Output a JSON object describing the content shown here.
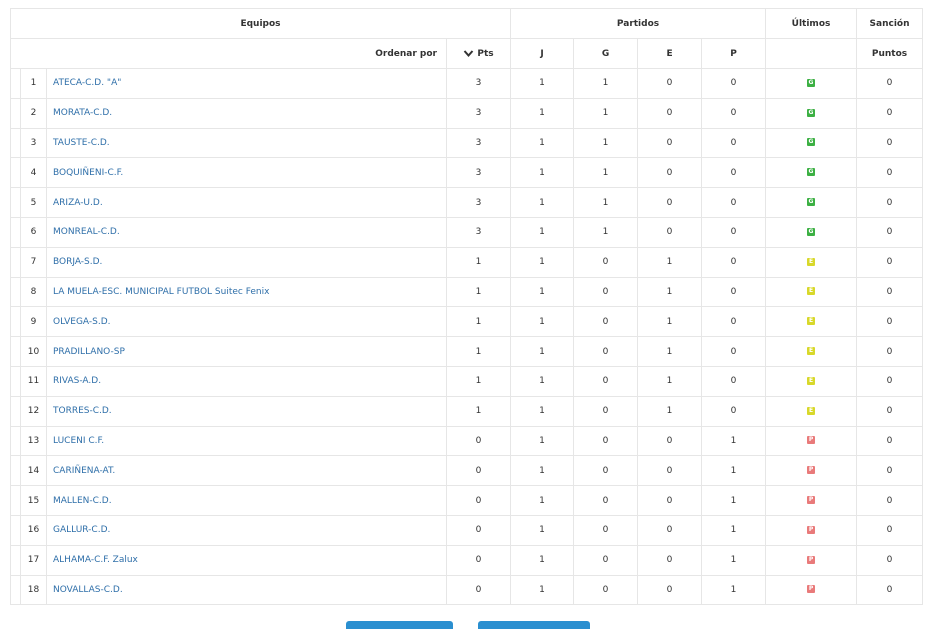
{
  "header": {
    "equipos": "Equipos",
    "partidos": "Partidos",
    "ultimos": "Últimos",
    "sancion": "Sanción",
    "ordenar_por": "Ordenar por",
    "pts": "Pts",
    "j": "J",
    "g": "G",
    "e": "E",
    "p": "P",
    "puntos": "Puntos"
  },
  "result_colors": {
    "G": "#3cb043",
    "E": "#d8d82a",
    "P": "#e97a7a"
  },
  "rows": [
    {
      "pos": "1",
      "team": "ATECA-C.D. \"A\"",
      "pts": "3",
      "j": "1",
      "g": "1",
      "e": "0",
      "p": "0",
      "last": "G",
      "sancion": "0"
    },
    {
      "pos": "2",
      "team": "MORATA-C.D.",
      "pts": "3",
      "j": "1",
      "g": "1",
      "e": "0",
      "p": "0",
      "last": "G",
      "sancion": "0"
    },
    {
      "pos": "3",
      "team": "TAUSTE-C.D.",
      "pts": "3",
      "j": "1",
      "g": "1",
      "e": "0",
      "p": "0",
      "last": "G",
      "sancion": "0"
    },
    {
      "pos": "4",
      "team": "BOQUIÑENI-C.F.",
      "pts": "3",
      "j": "1",
      "g": "1",
      "e": "0",
      "p": "0",
      "last": "G",
      "sancion": "0"
    },
    {
      "pos": "5",
      "team": "ARIZA-U.D.",
      "pts": "3",
      "j": "1",
      "g": "1",
      "e": "0",
      "p": "0",
      "last": "G",
      "sancion": "0"
    },
    {
      "pos": "6",
      "team": "MONREAL-C.D.",
      "pts": "3",
      "j": "1",
      "g": "1",
      "e": "0",
      "p": "0",
      "last": "G",
      "sancion": "0"
    },
    {
      "pos": "7",
      "team": "BORJA-S.D.",
      "pts": "1",
      "j": "1",
      "g": "0",
      "e": "1",
      "p": "0",
      "last": "E",
      "sancion": "0"
    },
    {
      "pos": "8",
      "team": "LA MUELA-ESC. MUNICIPAL FUTBOL Suitec Fenix",
      "pts": "1",
      "j": "1",
      "g": "0",
      "e": "1",
      "p": "0",
      "last": "E",
      "sancion": "0"
    },
    {
      "pos": "9",
      "team": "OLVEGA-S.D.",
      "pts": "1",
      "j": "1",
      "g": "0",
      "e": "1",
      "p": "0",
      "last": "E",
      "sancion": "0"
    },
    {
      "pos": "10",
      "team": "PRADILLANO-SP",
      "pts": "1",
      "j": "1",
      "g": "0",
      "e": "1",
      "p": "0",
      "last": "E",
      "sancion": "0"
    },
    {
      "pos": "11",
      "team": "RIVAS-A.D.",
      "pts": "1",
      "j": "1",
      "g": "0",
      "e": "1",
      "p": "0",
      "last": "E",
      "sancion": "0"
    },
    {
      "pos": "12",
      "team": "TORRES-C.D.",
      "pts": "1",
      "j": "1",
      "g": "0",
      "e": "1",
      "p": "0",
      "last": "E",
      "sancion": "0"
    },
    {
      "pos": "13",
      "team": "LUCENI C.F.",
      "pts": "0",
      "j": "1",
      "g": "0",
      "e": "0",
      "p": "1",
      "last": "P",
      "sancion": "0"
    },
    {
      "pos": "14",
      "team": "CARIÑENA-AT.",
      "pts": "0",
      "j": "1",
      "g": "0",
      "e": "0",
      "p": "1",
      "last": "P",
      "sancion": "0"
    },
    {
      "pos": "15",
      "team": "MALLEN-C.D.",
      "pts": "0",
      "j": "1",
      "g": "0",
      "e": "0",
      "p": "1",
      "last": "P",
      "sancion": "0"
    },
    {
      "pos": "16",
      "team": "GALLUR-C.D.",
      "pts": "0",
      "j": "1",
      "g": "0",
      "e": "0",
      "p": "1",
      "last": "P",
      "sancion": "0"
    },
    {
      "pos": "17",
      "team": "ALHAMA-C.F. Zalux",
      "pts": "0",
      "j": "1",
      "g": "0",
      "e": "0",
      "p": "1",
      "last": "P",
      "sancion": "0"
    },
    {
      "pos": "18",
      "team": "NOVALLAS-C.D.",
      "pts": "0",
      "j": "1",
      "g": "0",
      "e": "0",
      "p": "1",
      "last": "P",
      "sancion": "0"
    }
  ]
}
